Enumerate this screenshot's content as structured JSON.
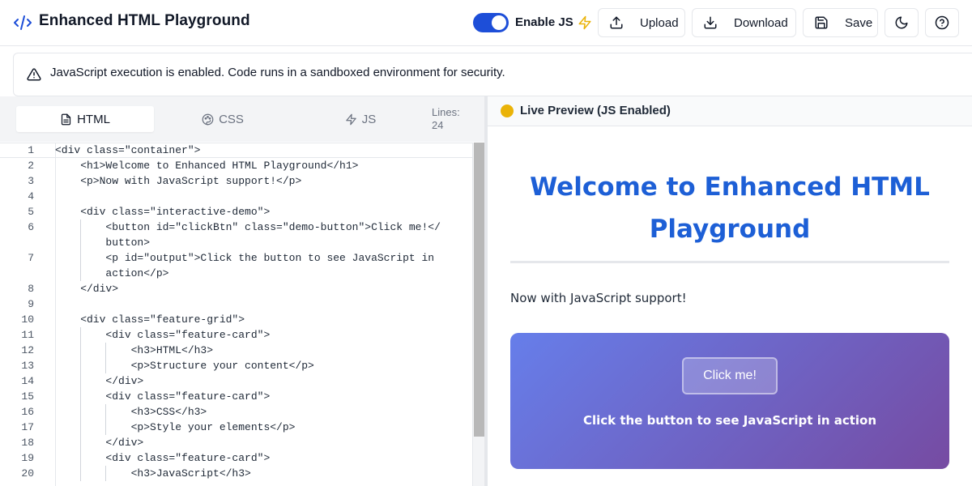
{
  "header": {
    "title": "Enhanced HTML Playground",
    "js_toggle": {
      "label": "Enable JS",
      "enabled": true
    },
    "buttons": {
      "upload": "Upload",
      "download": "Download",
      "save": "Save"
    }
  },
  "alert": {
    "text": "JavaScript execution is enabled. Code runs in a sandboxed environment for security."
  },
  "editor": {
    "tabs": [
      {
        "label": "HTML",
        "active": true
      },
      {
        "label": "CSS",
        "active": false
      },
      {
        "label": "JS",
        "active": false
      }
    ],
    "lines_label": "Lines:",
    "lines_count": "24",
    "code": [
      {
        "n": "1",
        "text": "<div class=\"container\">"
      },
      {
        "n": "2",
        "text": "    <h1>Welcome to Enhanced HTML Playground</h1>"
      },
      {
        "n": "3",
        "text": "    <p>Now with JavaScript support!</p>"
      },
      {
        "n": "4",
        "text": ""
      },
      {
        "n": "5",
        "text": "    <div class=\"interactive-demo\">"
      },
      {
        "n": "6",
        "text": "        <button id=\"clickBtn\" class=\"demo-button\">Click me!</"
      },
      {
        "n": "",
        "text": "        button>"
      },
      {
        "n": "7",
        "text": "        <p id=\"output\">Click the button to see JavaScript in"
      },
      {
        "n": "",
        "text": "        action</p>"
      },
      {
        "n": "8",
        "text": "    </div>"
      },
      {
        "n": "9",
        "text": ""
      },
      {
        "n": "10",
        "text": "    <div class=\"feature-grid\">"
      },
      {
        "n": "11",
        "text": "        <div class=\"feature-card\">"
      },
      {
        "n": "12",
        "text": "            <h3>HTML</h3>"
      },
      {
        "n": "13",
        "text": "            <p>Structure your content</p>"
      },
      {
        "n": "14",
        "text": "        </div>"
      },
      {
        "n": "15",
        "text": "        <div class=\"feature-card\">"
      },
      {
        "n": "16",
        "text": "            <h3>CSS</h3>"
      },
      {
        "n": "17",
        "text": "            <p>Style your elements</p>"
      },
      {
        "n": "18",
        "text": "        </div>"
      },
      {
        "n": "19",
        "text": "        <div class=\"feature-card\">"
      },
      {
        "n": "20",
        "text": "            <h3>JavaScript</h3>"
      }
    ]
  },
  "preview": {
    "title": "Live Preview (JS Enabled)",
    "heading": "Welcome to Enhanced HTML Playground",
    "paragraph": "Now with JavaScript support!",
    "demo_button": "Click me!",
    "demo_output": "Click the button to see JavaScript in action"
  },
  "colors": {
    "accent": "#1d4ed8",
    "preview_heading": "#1d5fd6",
    "status_dot": "#eab308",
    "bolt": "#eab308",
    "gradient_start": "#667eea",
    "gradient_end": "#764ba2"
  },
  "icons": {
    "logo": "code-icon",
    "js_indicator": "bolt-icon",
    "upload": "upload-icon",
    "download": "download-icon",
    "save": "save-icon",
    "theme": "moon-icon",
    "help": "help-circle-icon",
    "alert": "warning-triangle-icon",
    "tab_html": "file-icon",
    "tab_css": "palette-icon",
    "tab_js": "bolt-icon"
  }
}
